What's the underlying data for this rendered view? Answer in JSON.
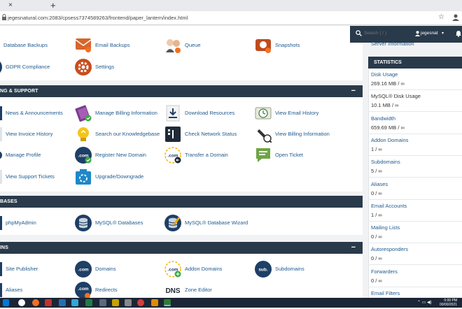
{
  "browser": {
    "tab_close": "×",
    "tab_new": "+",
    "url": "jegesnatural.com:2083/cpsess7374589263/frontend/paper_lantern/index.html",
    "star_icon": "star-icon",
    "profile_icon": "profile-icon"
  },
  "header": {
    "search_placeholder": "Search ( / )",
    "username": "jegesnat",
    "caret": "▾"
  },
  "sections": {
    "files_partial": {
      "items": [
        {
          "label": "Database Backups",
          "icon": "database-backup-icon"
        },
        {
          "label": "Email Backups",
          "icon": "email-backup-icon"
        },
        {
          "label": "Queue",
          "icon": "queue-icon"
        },
        {
          "label": "Snapshots",
          "icon": "snapshot-icon"
        },
        {
          "label": "GDPR Compliance",
          "icon": "gdpr-icon"
        },
        {
          "label": "Settings",
          "icon": "settings-icon"
        }
      ]
    },
    "billing": {
      "title": "NG & SUPPORT",
      "toggle": "−",
      "items": [
        {
          "label": "News & Announcements",
          "icon": "news-icon"
        },
        {
          "label": "Manage Billing Information",
          "icon": "manage-billing-icon"
        },
        {
          "label": "Download Resources",
          "icon": "download-icon"
        },
        {
          "label": "View Email History",
          "icon": "email-history-icon"
        },
        {
          "label": "View Invoice History",
          "icon": "invoice-icon"
        },
        {
          "label": "Search our Knowledgebase",
          "icon": "knowledgebase-icon"
        },
        {
          "label": "Check Network Status",
          "icon": "network-status-icon"
        },
        {
          "label": "View Billing Information",
          "icon": "billing-info-icon"
        },
        {
          "label": "Manage Profile",
          "icon": "profile-icon"
        },
        {
          "label": "Register New Domain",
          "icon": "register-domain-icon"
        },
        {
          "label": "Transfer a Domain",
          "icon": "transfer-domain-icon"
        },
        {
          "label": "Open Ticket",
          "icon": "ticket-icon"
        },
        {
          "label": "View Support Tickets",
          "icon": "support-tickets-icon"
        },
        {
          "label": "Upgrade/Downgrade",
          "icon": "upgrade-icon"
        }
      ]
    },
    "databases": {
      "title": "BASES",
      "toggle": "−",
      "items": [
        {
          "label": "phpMyAdmin",
          "icon": "phpmyadmin-icon"
        },
        {
          "label": "MySQL® Databases",
          "icon": "mysql-databases-icon"
        },
        {
          "label": "MySQL® Database Wizard",
          "icon": "mysql-wizard-icon"
        }
      ]
    },
    "domains": {
      "title": "INS",
      "toggle": "−",
      "items": [
        {
          "label": "Site Publisher",
          "icon": "site-publisher-icon"
        },
        {
          "label": "Domains",
          "icon": "domains-icon",
          "badge": ".com"
        },
        {
          "label": "Addon Domains",
          "icon": "addon-domains-icon",
          "badge": ".com"
        },
        {
          "label": "Subdomains",
          "icon": "subdomains-icon",
          "badge": "sub."
        },
        {
          "label": "Aliases",
          "icon": "aliases-icon"
        },
        {
          "label": "Redirects",
          "icon": "redirects-icon",
          "badge": ".com"
        },
        {
          "label": "Zone Editor",
          "icon": "zone-editor-icon",
          "badge": "DNS"
        }
      ]
    }
  },
  "sidebar": {
    "server_info": "Server Information",
    "stats_title": "STATISTICS",
    "stats": [
      {
        "label": "Disk Usage",
        "value": "269.16 MB / ∞",
        "link": true
      },
      {
        "label": "MySQL® Disk Usage",
        "value": "10.1 MB / ∞",
        "link": false
      },
      {
        "label": "Bandwidth",
        "value": "659.69 MB / ∞",
        "link": true
      },
      {
        "label": "Addon Domains",
        "value": "1 / ∞",
        "link": true
      },
      {
        "label": "Subdomains",
        "value": "5 / ∞",
        "link": true
      },
      {
        "label": "Aliases",
        "value": "0 / ∞",
        "link": true
      },
      {
        "label": "Email Accounts",
        "value": "1 / ∞",
        "link": true
      },
      {
        "label": "Mailing Lists",
        "value": "0 / ∞",
        "link": true
      },
      {
        "label": "Autoresponders",
        "value": "0 / ∞",
        "link": true
      },
      {
        "label": "Forwarders",
        "value": "0 / ∞",
        "link": true
      },
      {
        "label": "Email Filters",
        "value": "",
        "link": true
      }
    ]
  },
  "colors": {
    "dark_header": "#293a4a",
    "link": "#1f5a8f",
    "icon_blue": "#1e3f66",
    "icon_orange": "#f37021",
    "icon_green": "#3aa845"
  },
  "taskbar": {
    "time_line1": "0:00 PM",
    "time_line2": "00/00/2021"
  }
}
